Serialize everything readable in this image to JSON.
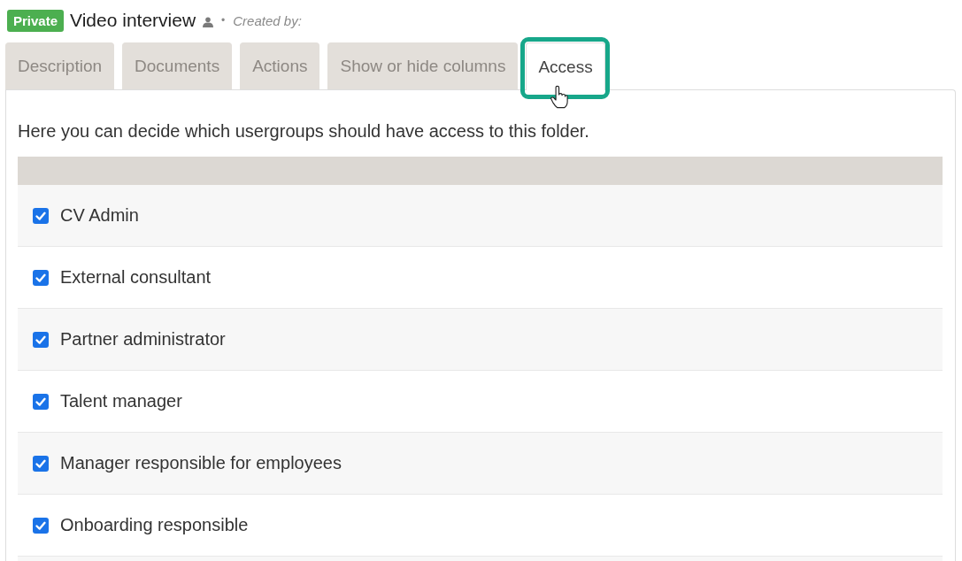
{
  "header": {
    "badge": "Private",
    "title": "Video interview",
    "separator": "•",
    "created_by": "Created by:"
  },
  "tabs": [
    {
      "label": "Description",
      "selected": false,
      "highlighted": false
    },
    {
      "label": "Documents",
      "selected": false,
      "highlighted": false
    },
    {
      "label": "Actions",
      "selected": false,
      "highlighted": false
    },
    {
      "label": "Show or hide columns",
      "selected": false,
      "highlighted": false
    },
    {
      "label": "Access",
      "selected": true,
      "highlighted": true
    }
  ],
  "access_panel": {
    "intro": "Here you can decide which usergroups should have access to this folder.",
    "usergroups": [
      {
        "label": "CV Admin",
        "checked": true
      },
      {
        "label": "External consultant",
        "checked": true
      },
      {
        "label": "Partner administrator",
        "checked": true
      },
      {
        "label": "Talent manager",
        "checked": true
      },
      {
        "label": "Manager responsible for employees",
        "checked": true
      },
      {
        "label": "Onboarding responsible",
        "checked": true
      }
    ]
  }
}
